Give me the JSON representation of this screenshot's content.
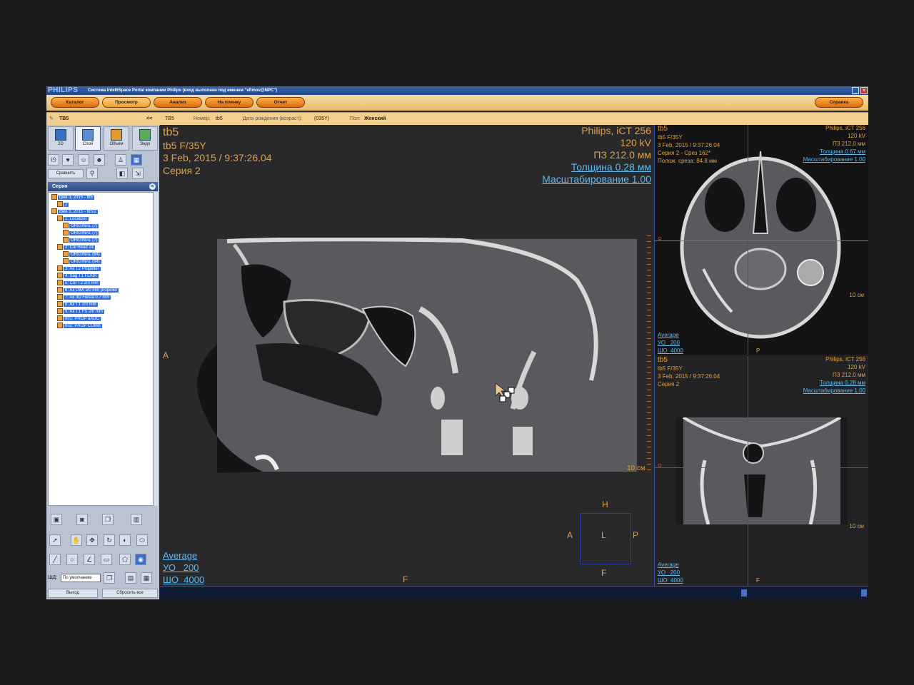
{
  "window": {
    "brand": "PHILIPS",
    "title": "Система IntelliSpace Portal компании Philips (вход выполнен под именем \"efimov@NPC\")"
  },
  "toolbar": {
    "tabs": [
      "Каталог",
      "Просмотр",
      "Анализ",
      "На пленку",
      "Отчет"
    ],
    "help": "Справка"
  },
  "patient_bar": {
    "left_name": "TB5",
    "collapse": "<<",
    "name": "TB5",
    "number_label": "Номер:",
    "number": "tb5",
    "dob_label": "Дата рождения (возраст):",
    "dob": "(035Y)",
    "sex_label": "Пол:",
    "sex": "Женский"
  },
  "modes": [
    {
      "label": "2D",
      "color": "#3a6fc7"
    },
    {
      "label": "Слой",
      "color": "#3a6fc7"
    },
    {
      "label": "Объем",
      "color": "#e39b2a"
    },
    {
      "label": "Эндо",
      "color": "#5aaa5a"
    }
  ],
  "left_tools": {
    "compare": "Сравнить"
  },
  "series_panel": {
    "title": "Серия",
    "items": [
      {
        "label": "фев 3, 2015 - tb5",
        "indent": 0
      },
      {
        "label": "2",
        "indent": 1
      },
      {
        "label": "фев 3, 2015 - tb5/2",
        "indent": 0
      },
      {
        "label": "1: Localizer",
        "indent": 1
      },
      {
        "label": "ORIGINAL (7)",
        "indent": 2
      },
      {
        "label": "ORIGINAL (7)",
        "indent": 2
      },
      {
        "label": "ORIGINAL (7)",
        "indent": 2
      },
      {
        "label": "2: Cal Head 24",
        "indent": 1
      },
      {
        "label": "ORIGINAL (64)",
        "indent": 2
      },
      {
        "label": "ORIGINAL (64)",
        "indent": 2
      },
      {
        "label": "3: Ax T2 Propeller",
        "indent": 1
      },
      {
        "label": "4: Sag T1 FLAIR",
        "indent": 1
      },
      {
        "label": "5: Cor T2 2/0 mm",
        "indent": 1
      },
      {
        "label": "6: Ax DWI 3/0 mm propeller",
        "indent": 1
      },
      {
        "label": "7: Ax 3D Fiesta 0.7 mm",
        "indent": 1
      },
      {
        "label": "8: Ax T1 2/0 mm",
        "indent": 1
      },
      {
        "label": "9: Ax T1 FS 2/0 mm",
        "indent": 1
      },
      {
        "label": "601: PROP aADC",
        "indent": 1
      },
      {
        "label": "602: PROP COMB",
        "indent": 1
      }
    ]
  },
  "bottom_left": {
    "wl_label": "ШД:",
    "wl_value": "По умолчанию",
    "exit": "Выход",
    "reset_all": "Сбросить все"
  },
  "main_view": {
    "patient": "tb5",
    "sex_age": "tb5 F/35Y",
    "datetime": "3 Feb, 2015 / 9:37:26.04",
    "series": "Серия 2",
    "scanner": "Philips, iCT 256",
    "kv": "120 kV",
    "fov": "ПЗ 212.0 мм",
    "thickness": "Толщина 0.28 мм",
    "zoom": "Масштабирование 1.00",
    "render": "Average",
    "wl": "УО   200",
    "ww": "ШО  4000",
    "scale": "10 см",
    "orient_left": "A",
    "orient_bottom": "F",
    "cube": {
      "top": "H",
      "left": "A",
      "center": "L",
      "right": "P",
      "bottom": "F"
    }
  },
  "axial_view": {
    "patient": "tb5",
    "sex_age": "tb5 F/35Y",
    "datetime": "3 Feb, 2015 / 9:37:26.04",
    "series": "Серия 2 - Срез 162*",
    "position": "Полож. среза: 84.8 мм",
    "scanner": "Philips, iCT 256",
    "kv": "120 kV",
    "fov": "ПЗ 212.0 мм",
    "thickness": "Толщина 0.67 мм",
    "zoom": "Масштабирование 1.00",
    "render": "Average",
    "wl": "УО   200",
    "ww": "ШО  4000",
    "scale": "10 см",
    "orient_left": "R",
    "orient_bottom": "P"
  },
  "coronal_view": {
    "patient": "tb5",
    "sex_age": "tb5 F/35Y",
    "datetime": "3 Feb, 2015 / 9:37:26.04",
    "series": "Серия 2",
    "scanner": "Philips, iCT 256",
    "kv": "120 kV",
    "fov": "ПЗ 212.0 мм",
    "thickness": "Толщина 0.28 мм",
    "zoom": "Масштабирование 1.00",
    "render": "Average",
    "wl": "УО   200",
    "ww": "ШО  4000",
    "scale": "10 см",
    "orient_left": "R",
    "orient_bottom": "F"
  }
}
